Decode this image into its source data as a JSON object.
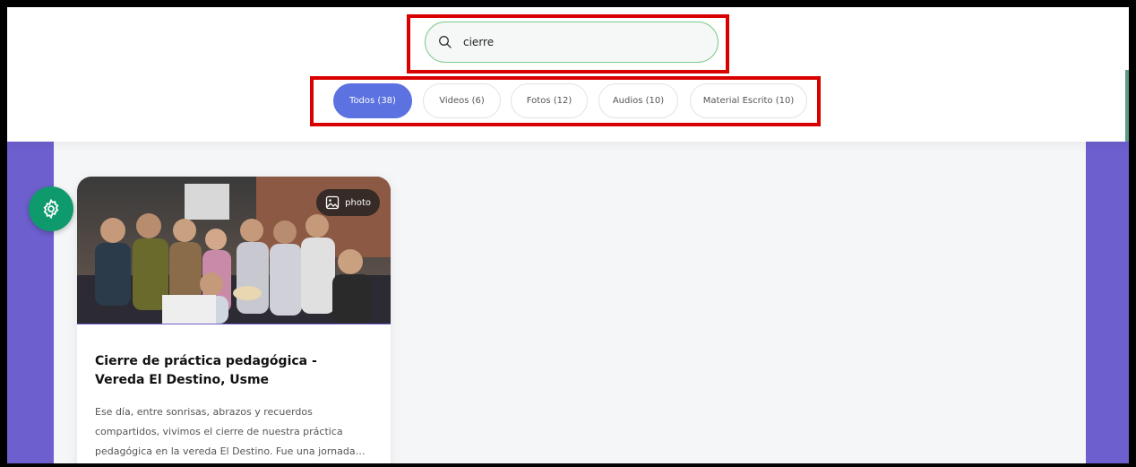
{
  "search": {
    "value": "cierre",
    "placeholder": ""
  },
  "tabs": [
    {
      "label": "Todos (38)",
      "active": true
    },
    {
      "label": "Videos (6)",
      "active": false
    },
    {
      "label": "Fotos (12)",
      "active": false
    },
    {
      "label": "Audios (10)",
      "active": false
    },
    {
      "label": "Material Escrito (10)",
      "active": false
    }
  ],
  "card": {
    "badge_label": "photo",
    "title": "Cierre de práctica pedagógica - Vereda El Destino, Usme",
    "description": "Ese día, entre sonrisas, abrazos y recuerdos compartidos, vivimos el cierre de nuestra práctica pedagógica en la vereda El Destino. Fue una jornada llena de emociones en..."
  },
  "colors": {
    "accent": "#5b72e0",
    "side_panel": "#6d5fce",
    "fab": "#0f9a6e",
    "highlight": "#d90000"
  },
  "icons": [
    "search-icon",
    "settings-gear-icon",
    "image-icon"
  ]
}
